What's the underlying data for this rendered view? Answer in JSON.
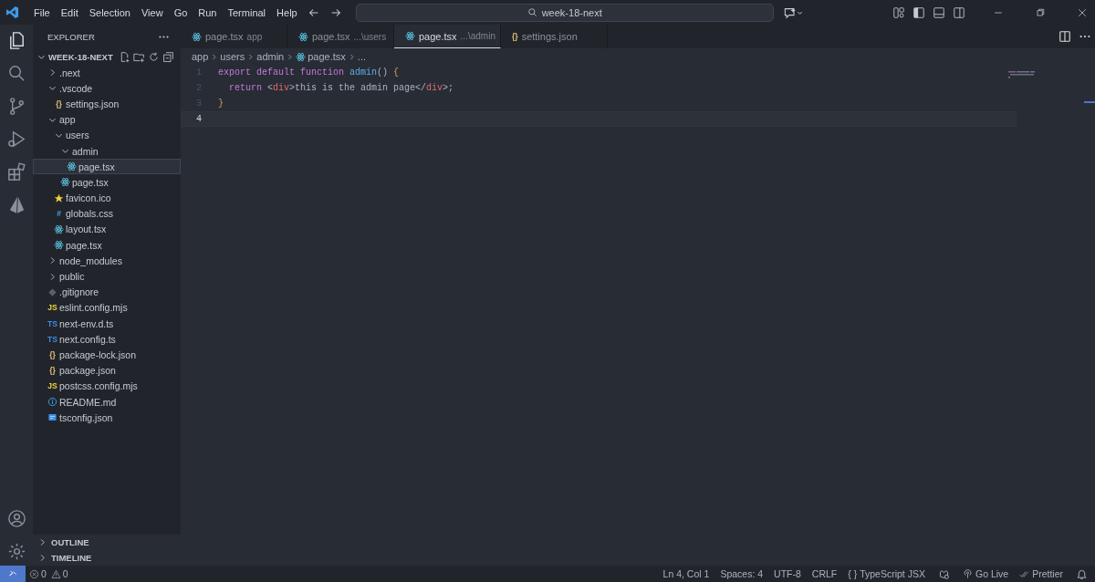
{
  "menu": [
    "File",
    "Edit",
    "Selection",
    "View",
    "Go",
    "Run",
    "Terminal",
    "Help"
  ],
  "search": {
    "value": "week-18-next"
  },
  "explorer": {
    "title": "EXPLORER",
    "root": "WEEK-18-NEXT",
    "root_expanded": true,
    "tree": [
      {
        "name": ".next",
        "kind": "folder",
        "expanded": false,
        "selected": false
      },
      {
        "name": ".vscode",
        "kind": "folder",
        "expanded": true,
        "selected": false,
        "children": [
          {
            "name": "settings.json",
            "kind": "json",
            "badge": "{}",
            "selected": false
          }
        ]
      },
      {
        "name": "app",
        "kind": "folder",
        "expanded": true,
        "selected": false,
        "children": [
          {
            "name": "users",
            "kind": "folder",
            "expanded": true,
            "selected": false,
            "children": [
              {
                "name": "admin",
                "kind": "folder",
                "expanded": true,
                "selected": false,
                "children": [
                  {
                    "name": "page.tsx",
                    "kind": "react",
                    "selected": true
                  }
                ]
              },
              {
                "name": "page.tsx",
                "kind": "react",
                "selected": false
              }
            ]
          },
          {
            "name": "favicon.ico",
            "kind": "star",
            "selected": false
          },
          {
            "name": "globals.css",
            "kind": "css",
            "badge": "#",
            "selected": false
          },
          {
            "name": "layout.tsx",
            "kind": "react",
            "selected": false
          },
          {
            "name": "page.tsx",
            "kind": "react",
            "selected": false
          }
        ]
      },
      {
        "name": "node_modules",
        "kind": "folder",
        "expanded": false,
        "selected": false
      },
      {
        "name": "public",
        "kind": "folder",
        "expanded": false,
        "selected": false
      },
      {
        "name": ".gitignore",
        "kind": "git",
        "selected": false
      },
      {
        "name": "eslint.config.mjs",
        "kind": "js",
        "badge": "JS",
        "selected": false
      },
      {
        "name": "next-env.d.ts",
        "kind": "ts",
        "badge": "TS",
        "selected": false
      },
      {
        "name": "next.config.ts",
        "kind": "ts",
        "badge": "TS",
        "selected": false
      },
      {
        "name": "package-lock.json",
        "kind": "json",
        "badge": "{}",
        "selected": false
      },
      {
        "name": "package.json",
        "kind": "json",
        "badge": "{}",
        "selected": false
      },
      {
        "name": "postcss.config.mjs",
        "kind": "js",
        "badge": "JS",
        "selected": false
      },
      {
        "name": "README.md",
        "kind": "info",
        "selected": false
      },
      {
        "name": "tsconfig.json",
        "kind": "tsconfig",
        "selected": false
      }
    ],
    "sections": [
      {
        "label": "OUTLINE",
        "expanded": false
      },
      {
        "label": "TIMELINE",
        "expanded": false
      }
    ]
  },
  "tabs": [
    {
      "label": "page.tsx",
      "description": "app",
      "kind": "react",
      "selected": false
    },
    {
      "label": "page.tsx",
      "description": "...\\users",
      "kind": "react",
      "selected": false
    },
    {
      "label": "page.tsx",
      "description": "...\\admin",
      "kind": "react",
      "selected": true
    },
    {
      "label": "settings.json",
      "kind": "json",
      "badge": "{}",
      "selected": false
    }
  ],
  "breadcrumb": [
    {
      "label": "app",
      "kind": "folder"
    },
    {
      "label": "users",
      "kind": "folder"
    },
    {
      "label": "admin",
      "kind": "folder"
    },
    {
      "label": "page.tsx",
      "kind": "react"
    },
    {
      "label": "...",
      "kind": "symbol"
    }
  ],
  "code": [
    {
      "number": "1",
      "current": false,
      "tokens": [
        {
          "text": "export default function ",
          "kind": "keyword"
        },
        {
          "text": "admin",
          "kind": "function"
        },
        {
          "text": "() ",
          "kind": "plain"
        },
        {
          "text": "{",
          "kind": "brace"
        }
      ]
    },
    {
      "number": "2",
      "current": false,
      "tokens": [
        {
          "text": "  return ",
          "kind": "keyword"
        },
        {
          "text": "<",
          "kind": "plain"
        },
        {
          "text": "div",
          "kind": "tag"
        },
        {
          "text": ">this is the admin page</",
          "kind": "plain"
        },
        {
          "text": "div",
          "kind": "tag"
        },
        {
          "text": ">;",
          "kind": "plain"
        }
      ]
    },
    {
      "number": "3",
      "current": false,
      "tokens": [
        {
          "text": "}",
          "kind": "brace"
        }
      ]
    },
    {
      "number": "4",
      "current": true
    }
  ],
  "status": {
    "errors": "0",
    "warnings": "0",
    "items": [
      {
        "label": "Ln 4, Col 1",
        "kind": "text"
      },
      {
        "label": "Spaces: 4",
        "kind": "text"
      },
      {
        "label": "UTF-8",
        "kind": "text"
      },
      {
        "label": "CRLF",
        "kind": "text"
      },
      {
        "label": "TypeScript JSX",
        "kind": "language",
        "prefix": "{ }"
      },
      {
        "kind": "copilot"
      },
      {
        "label": "Go Live",
        "kind": "live"
      },
      {
        "label": "Prettier",
        "kind": "prettier"
      },
      {
        "kind": "bell"
      }
    ]
  }
}
